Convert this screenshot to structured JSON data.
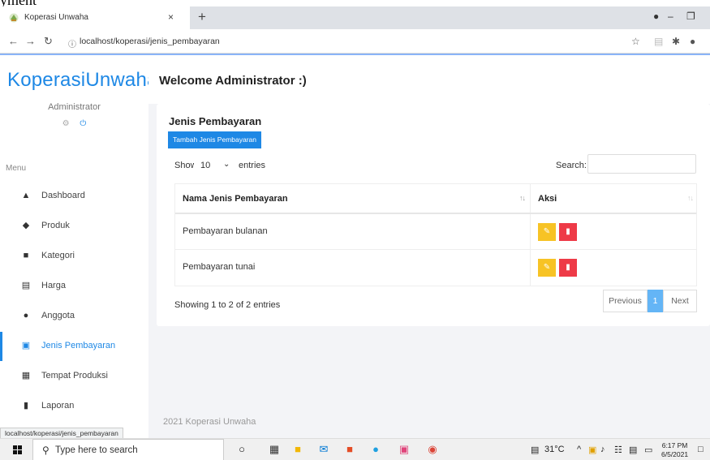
{
  "top_cut_text": "yment",
  "browser": {
    "tab_title": "Koperasi Unwaha",
    "tab_close": "×",
    "new_tab": "+",
    "url": "localhost/koperasi/jenis_pembayaran",
    "status_url": "localhost/koperasi/jenis_pembayaran"
  },
  "sidebar": {
    "logo": "KoperasiUnwaha",
    "admin_name": "Administrator",
    "menu_label": "Menu",
    "items": [
      {
        "label": "Dashboard",
        "icon": "home-icon",
        "active": false
      },
      {
        "label": "Produk",
        "icon": "tag-icon",
        "active": false
      },
      {
        "label": "Kategori",
        "icon": "category-icon",
        "active": false
      },
      {
        "label": "Harga",
        "icon": "price-icon",
        "active": false
      },
      {
        "label": "Anggota",
        "icon": "users-icon",
        "active": false
      },
      {
        "label": "Jenis Pembayaran",
        "icon": "wallet-icon",
        "active": true
      },
      {
        "label": "Tempat Produksi",
        "icon": "building-icon",
        "active": false
      },
      {
        "label": "Laporan",
        "icon": "report-icon",
        "active": false
      }
    ]
  },
  "header": {
    "welcome": "Welcome Administrator :)"
  },
  "card": {
    "title": "Jenis Pembayaran",
    "add_button": "Tambah Jenis Pembayaran",
    "show_label": "Show",
    "show_value": "10",
    "entries_label": "entries",
    "search_label": "Search:",
    "search_value": "",
    "columns": [
      "Nama Jenis Pembayaran",
      "Aksi"
    ],
    "rows": [
      {
        "name": "Pembayaran bulanan"
      },
      {
        "name": "Pembayaran tunai"
      }
    ],
    "info": "Showing 1 to 2 of 2 entries",
    "pager": {
      "previous": "Previous",
      "current": "1",
      "next": "Next"
    }
  },
  "footer": "2021 Koperasi Unwaha",
  "taskbar": {
    "search_placeholder": "Type here to search",
    "temperature": "31°C",
    "time": "6:17 PM",
    "date": "6/5/2021"
  },
  "colors": {
    "primary": "#1e88e5",
    "edit": "#f7c325",
    "delete": "#ee3a47",
    "pager_active": "#64b5f6"
  }
}
